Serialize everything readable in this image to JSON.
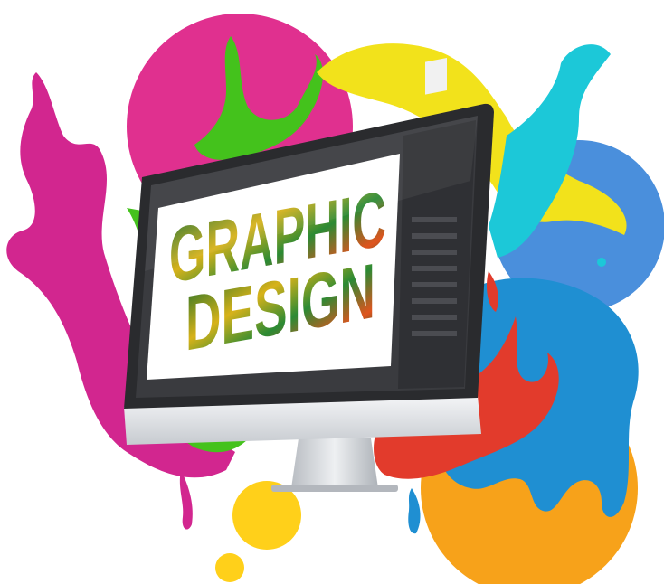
{
  "artwork": {
    "headline_line1": "GRAPHIC",
    "headline_line2": "DESIGN",
    "palette": {
      "magenta": "#d2268f",
      "pink_circle": "#e0308f",
      "green": "#44c21c",
      "yellow": "#f2e21b",
      "cyan": "#1cc8d8",
      "blue": "#1f8fd2",
      "red": "#e23b2c",
      "orange": "#f7a21a",
      "gold": "#ffd01a"
    }
  },
  "monitor": {
    "bezel_color": "#2a2b2e",
    "chin_color": "#dcdfe3",
    "stand_color": "#c9cdd2",
    "editor_panel_color": "#3a3b3f",
    "canvas_color": "#ffffff"
  }
}
